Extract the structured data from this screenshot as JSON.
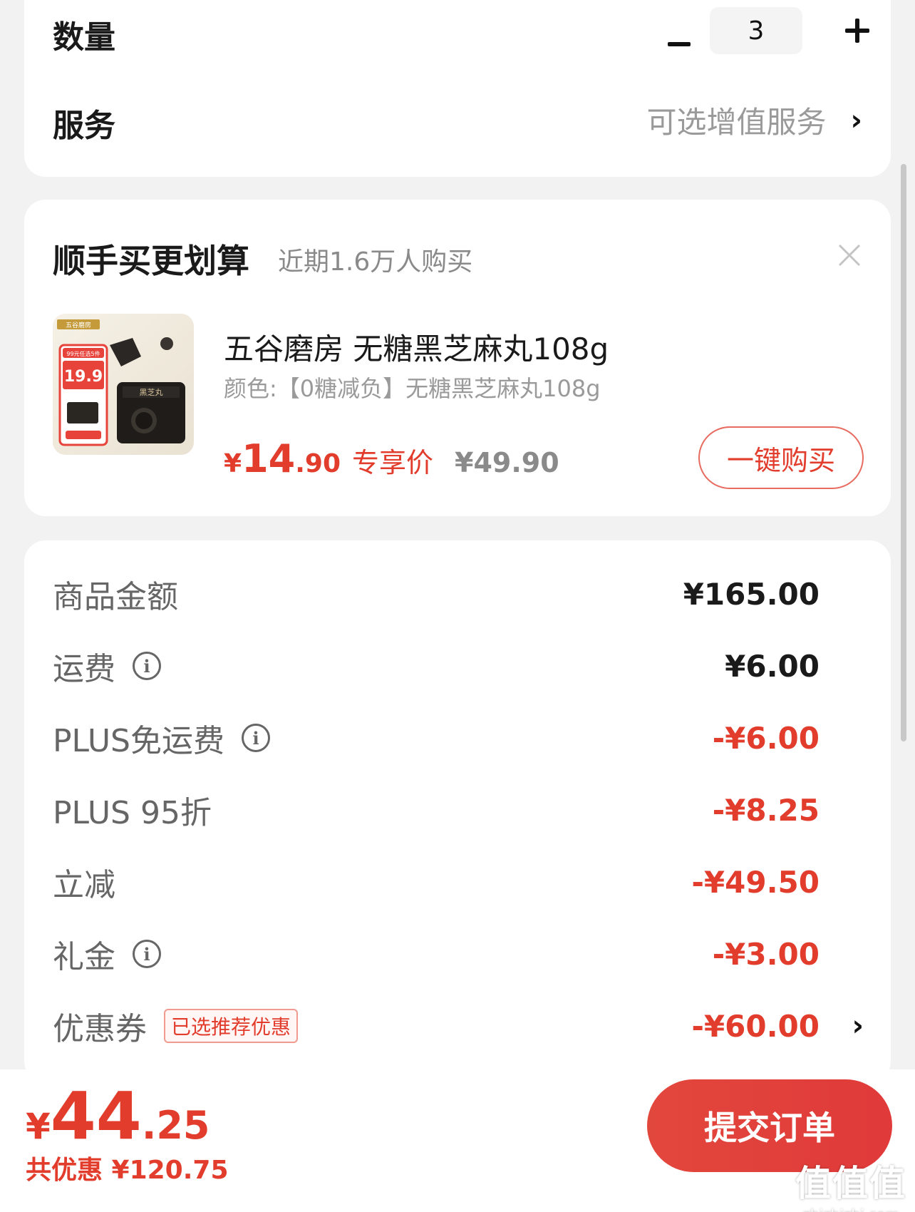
{
  "order_options": {
    "quantity_label": "数量",
    "quantity_value": "3",
    "service_label": "服务",
    "service_value": "可选增值服务"
  },
  "recommend": {
    "title": "顺手买更划算",
    "subtitle": "近期1.6万人购买",
    "product": {
      "name": "五谷磨房 无糖黑芝麻丸108g",
      "spec": "颜色:【0糖减负】无糖黑芝麻丸108g",
      "price_yen": "¥",
      "price_int": "14",
      "price_dec": ".90",
      "price_tag": "专享价",
      "original_price": "¥49.90",
      "buy_label": "一键购买",
      "thumbnail": {
        "brand": "五谷磨房",
        "promo": "99元任选5件",
        "price": "19.9",
        "box_label": "黑芝丸"
      }
    }
  },
  "summary": {
    "rows": [
      {
        "label": "商品金额",
        "value": "¥165.00"
      },
      {
        "label": "运费",
        "value": "¥6.00"
      },
      {
        "label": "PLUS免运费",
        "value": "-¥6.00"
      },
      {
        "label": "PLUS 95折",
        "value": "-¥8.25"
      },
      {
        "label": "立减",
        "value": "-¥49.50"
      },
      {
        "label": "礼金",
        "value": "-¥3.00"
      },
      {
        "label": "优惠券",
        "badge": "已选推荐优惠",
        "value": "-¥60.00"
      }
    ]
  },
  "footer": {
    "total_yen": "¥",
    "total_int": "44",
    "total_dec": ".25",
    "saved": "共优惠 ¥120.75",
    "submit_label": "提交订单"
  },
  "watermark": {
    "main": "值值值",
    "sub": "zhizhizhi.com"
  },
  "colors": {
    "accent_red": "#e23c2c",
    "background": "#f2f2f2",
    "card": "#ffffff"
  }
}
